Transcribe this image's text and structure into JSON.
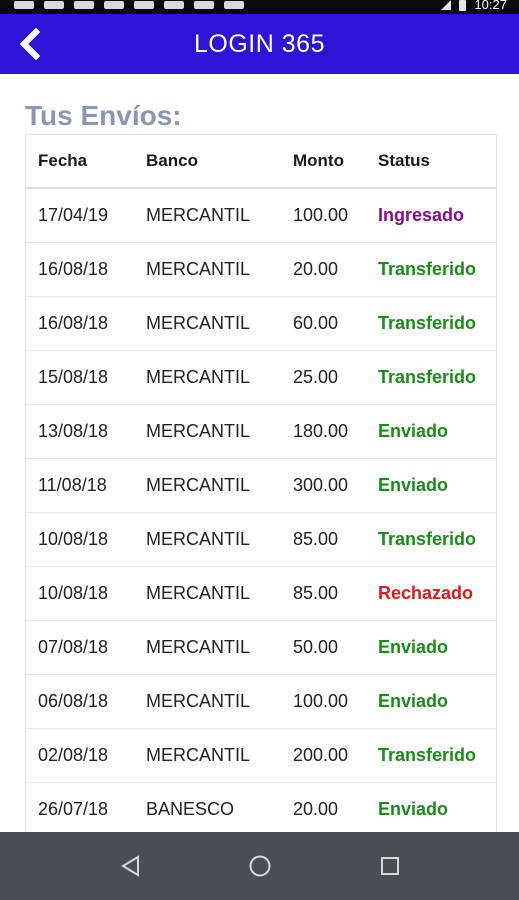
{
  "app": {
    "title": "LOGIN 365",
    "colors": {
      "appbar": "#2d14d6",
      "section_title": "#8b96b5",
      "status_ingresado": "#8a0a8a",
      "status_transferido": "#1a8c1a",
      "status_enviado": "#1a8c1a",
      "status_rechazado": "#e01818"
    }
  },
  "statusbar": {
    "time": "10:27"
  },
  "section": {
    "title": "Tus Envíos:"
  },
  "table": {
    "headers": {
      "fecha": "Fecha",
      "banco": "Banco",
      "monto": "Monto",
      "status": "Status"
    },
    "rows": [
      {
        "fecha": "17/04/19",
        "banco": "MERCANTIL",
        "monto": "100.00",
        "status": "Ingresado",
        "status_color": "#8a0a8a"
      },
      {
        "fecha": "16/08/18",
        "banco": "MERCANTIL",
        "monto": "20.00",
        "status": "Transferido",
        "status_color": "#1a8c1a"
      },
      {
        "fecha": "16/08/18",
        "banco": "MERCANTIL",
        "monto": "60.00",
        "status": "Transferido",
        "status_color": "#1a8c1a"
      },
      {
        "fecha": "15/08/18",
        "banco": "MERCANTIL",
        "monto": "25.00",
        "status": "Transferido",
        "status_color": "#1a8c1a"
      },
      {
        "fecha": "13/08/18",
        "banco": "MERCANTIL",
        "monto": "180.00",
        "status": "Enviado",
        "status_color": "#1a8c1a"
      },
      {
        "fecha": "11/08/18",
        "banco": "MERCANTIL",
        "monto": "300.00",
        "status": "Enviado",
        "status_color": "#1a8c1a"
      },
      {
        "fecha": "10/08/18",
        "banco": "MERCANTIL",
        "monto": "85.00",
        "status": "Transferido",
        "status_color": "#1a8c1a"
      },
      {
        "fecha": "10/08/18",
        "banco": "MERCANTIL",
        "monto": "85.00",
        "status": "Rechazado",
        "status_color": "#e01818"
      },
      {
        "fecha": "07/08/18",
        "banco": "MERCANTIL",
        "monto": "50.00",
        "status": "Enviado",
        "status_color": "#1a8c1a"
      },
      {
        "fecha": "06/08/18",
        "banco": "MERCANTIL",
        "monto": "100.00",
        "status": "Enviado",
        "status_color": "#1a8c1a"
      },
      {
        "fecha": "02/08/18",
        "banco": "MERCANTIL",
        "monto": "200.00",
        "status": "Transferido",
        "status_color": "#1a8c1a"
      },
      {
        "fecha": "26/07/18",
        "banco": "BANESCO",
        "monto": "20.00",
        "status": "Enviado",
        "status_color": "#1a8c1a"
      },
      {
        "fecha": "",
        "banco": "",
        "monto": "",
        "status": "",
        "status_color": "#1a8c1a"
      }
    ]
  },
  "navbar": {
    "icons": [
      "back-triangle-icon",
      "home-circle-icon",
      "recents-square-icon"
    ]
  }
}
